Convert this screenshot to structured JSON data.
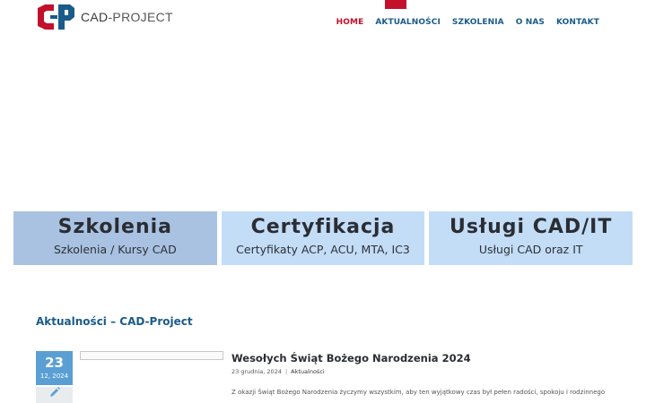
{
  "brand": {
    "name_bold": "CAD",
    "name_rest": "-PROJECT",
    "colors": {
      "red": "#c3102c",
      "blue": "#1a5b8a"
    }
  },
  "nav": {
    "items": [
      {
        "label": "HOME",
        "active": true
      },
      {
        "label": "AKTUALNOŚCI"
      },
      {
        "label": "SZKOLENIA"
      },
      {
        "label": "O NAS"
      },
      {
        "label": "KONTAKT"
      }
    ]
  },
  "cards": [
    {
      "title": "Szkolenia",
      "subtitle": "Szkolenia / Kursy CAD"
    },
    {
      "title": "Certyfikacja",
      "subtitle": "Certyfikaty ACP, ACU, MTA, IC3"
    },
    {
      "title": "Usługi CAD/IT",
      "subtitle": "Usługi CAD oraz IT"
    }
  ],
  "news": {
    "section_title": "Aktualności – CAD-Project",
    "post": {
      "day": "23",
      "month_year": "12, 2024",
      "title": "Wesołych Świąt Bożego Narodzenia 2024",
      "date": "23 grudnia, 2024",
      "separator": "|",
      "category": "Aktualności",
      "excerpt": "Z okazji Świąt Bożego Narodzenia życzymy wszystkim, aby ten wyjątkowy czas był pełen radości, spokoju i rodzinnego"
    }
  }
}
